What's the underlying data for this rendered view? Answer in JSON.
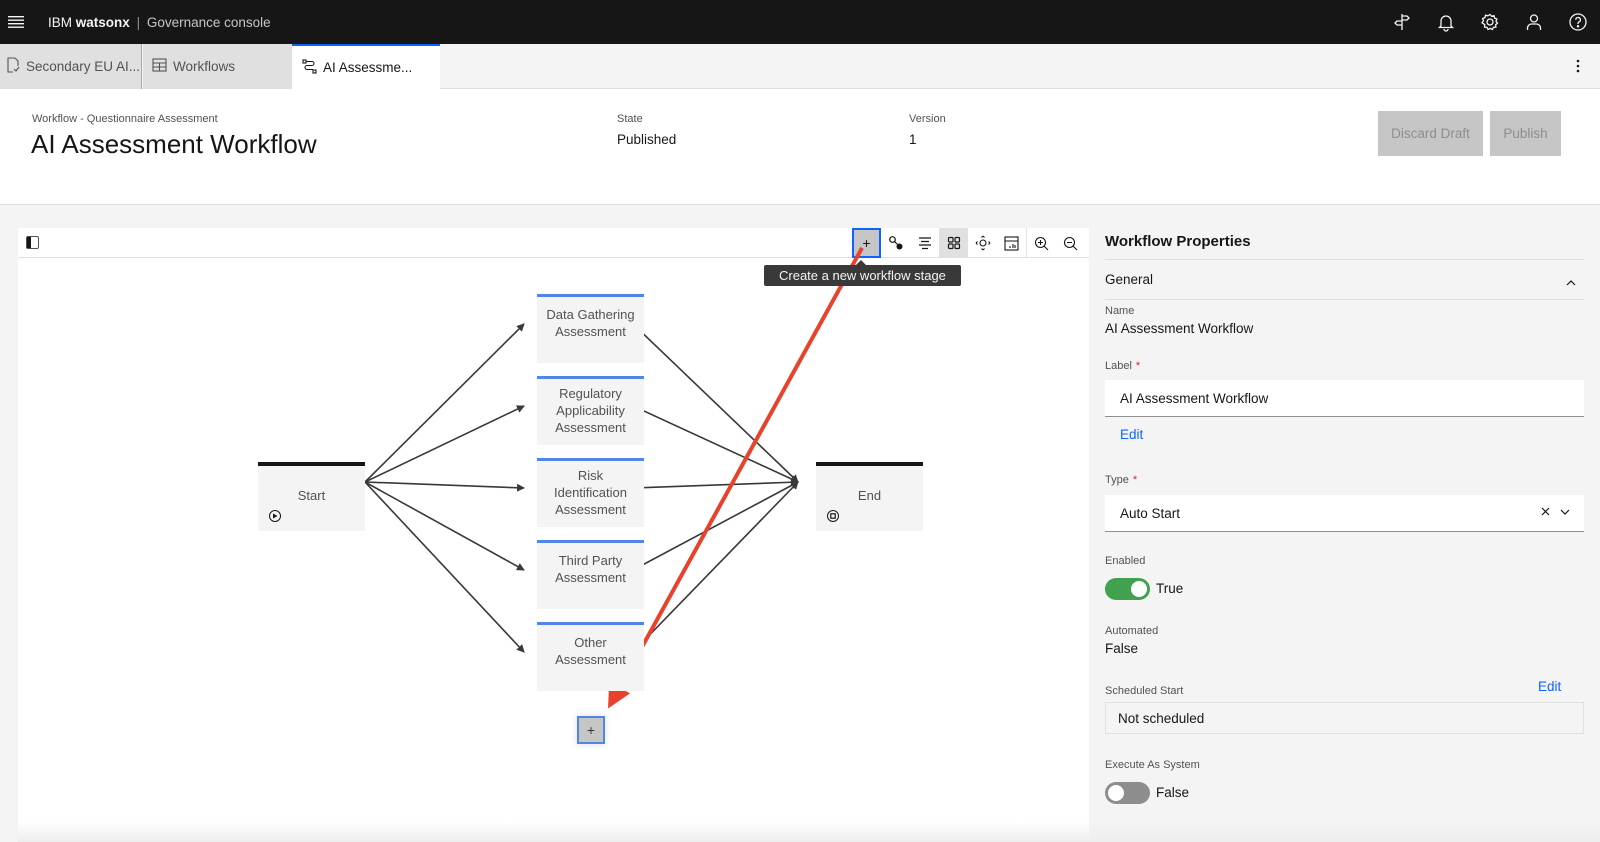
{
  "topbar": {
    "brand_ibm": "IBM",
    "brand_product": "watsonx",
    "brand_separator": "|",
    "brand_app": "Governance console",
    "icons": [
      "menu-icon",
      "guide-signpost-icon",
      "notification-bell-icon",
      "settings-gear-icon",
      "user-profile-icon",
      "help-icon"
    ]
  },
  "tabs": [
    {
      "label": "Secondary EU AI...",
      "icon": "document-check-icon",
      "active": false
    },
    {
      "label": "Workflows",
      "icon": "table-icon",
      "active": false
    },
    {
      "label": "AI Assessme...",
      "icon": "workflow-flow-icon",
      "active": true
    }
  ],
  "header": {
    "subtitle": "Workflow - Questionnaire Assessment",
    "title": "AI Assessment Workflow",
    "state_label": "State",
    "state_value": "Published",
    "version_label": "Version",
    "version_value": "1",
    "discard_label": "Discard Draft",
    "publish_label": "Publish"
  },
  "canvas": {
    "toolbar": [
      {
        "name": "add-stage",
        "icon": "plus-icon",
        "glyph": "+",
        "state": "active"
      },
      {
        "name": "connect",
        "icon": "connect-nodes-icon",
        "glyph": "",
        "state": ""
      },
      {
        "name": "align",
        "icon": "align-center-icon",
        "glyph": "",
        "state": ""
      },
      {
        "name": "grid",
        "icon": "grid-view-icon",
        "glyph": "",
        "state": "selected"
      },
      {
        "name": "fit",
        "icon": "fit-to-screen-icon",
        "glyph": "",
        "state": ""
      },
      {
        "name": "minimap",
        "icon": "minimap-icon",
        "glyph": "",
        "state": ""
      },
      {
        "name": "zoom-in",
        "icon": "zoom-in-icon",
        "glyph": "",
        "state": ""
      },
      {
        "name": "zoom-out",
        "icon": "zoom-out-icon",
        "glyph": "",
        "state": ""
      }
    ],
    "tooltip": "Create a new workflow stage",
    "start_node": "Start",
    "end_node": "End",
    "stages": [
      "Data Gathering Assessment",
      "Regulatory Applicability Assessment",
      "Risk Identification Assessment",
      "Third Party Assessment",
      "Other Assessment"
    ],
    "add_stage_glyph": "+",
    "annotation_arrow_color": "#e8412c"
  },
  "properties": {
    "title": "Workflow Properties",
    "section": "General",
    "name_label": "Name",
    "name_value": "AI Assessment Workflow",
    "label_label": "Label",
    "label_value": "AI Assessment Workflow",
    "edit_link": "Edit",
    "type_label": "Type",
    "type_value": "Auto Start",
    "enabled_label": "Enabled",
    "enabled_value": "True",
    "automated_label": "Automated",
    "automated_value": "False",
    "scheduled_label": "Scheduled Start",
    "scheduled_edit": "Edit",
    "scheduled_value": "Not scheduled",
    "execute_label": "Execute As System",
    "execute_value": "False",
    "required_mark": "*"
  },
  "colors": {
    "accent": "#0f62fe",
    "stage_border": "#4f86e8",
    "toggle_on": "#42a14f",
    "annotation": "#e8412c"
  }
}
